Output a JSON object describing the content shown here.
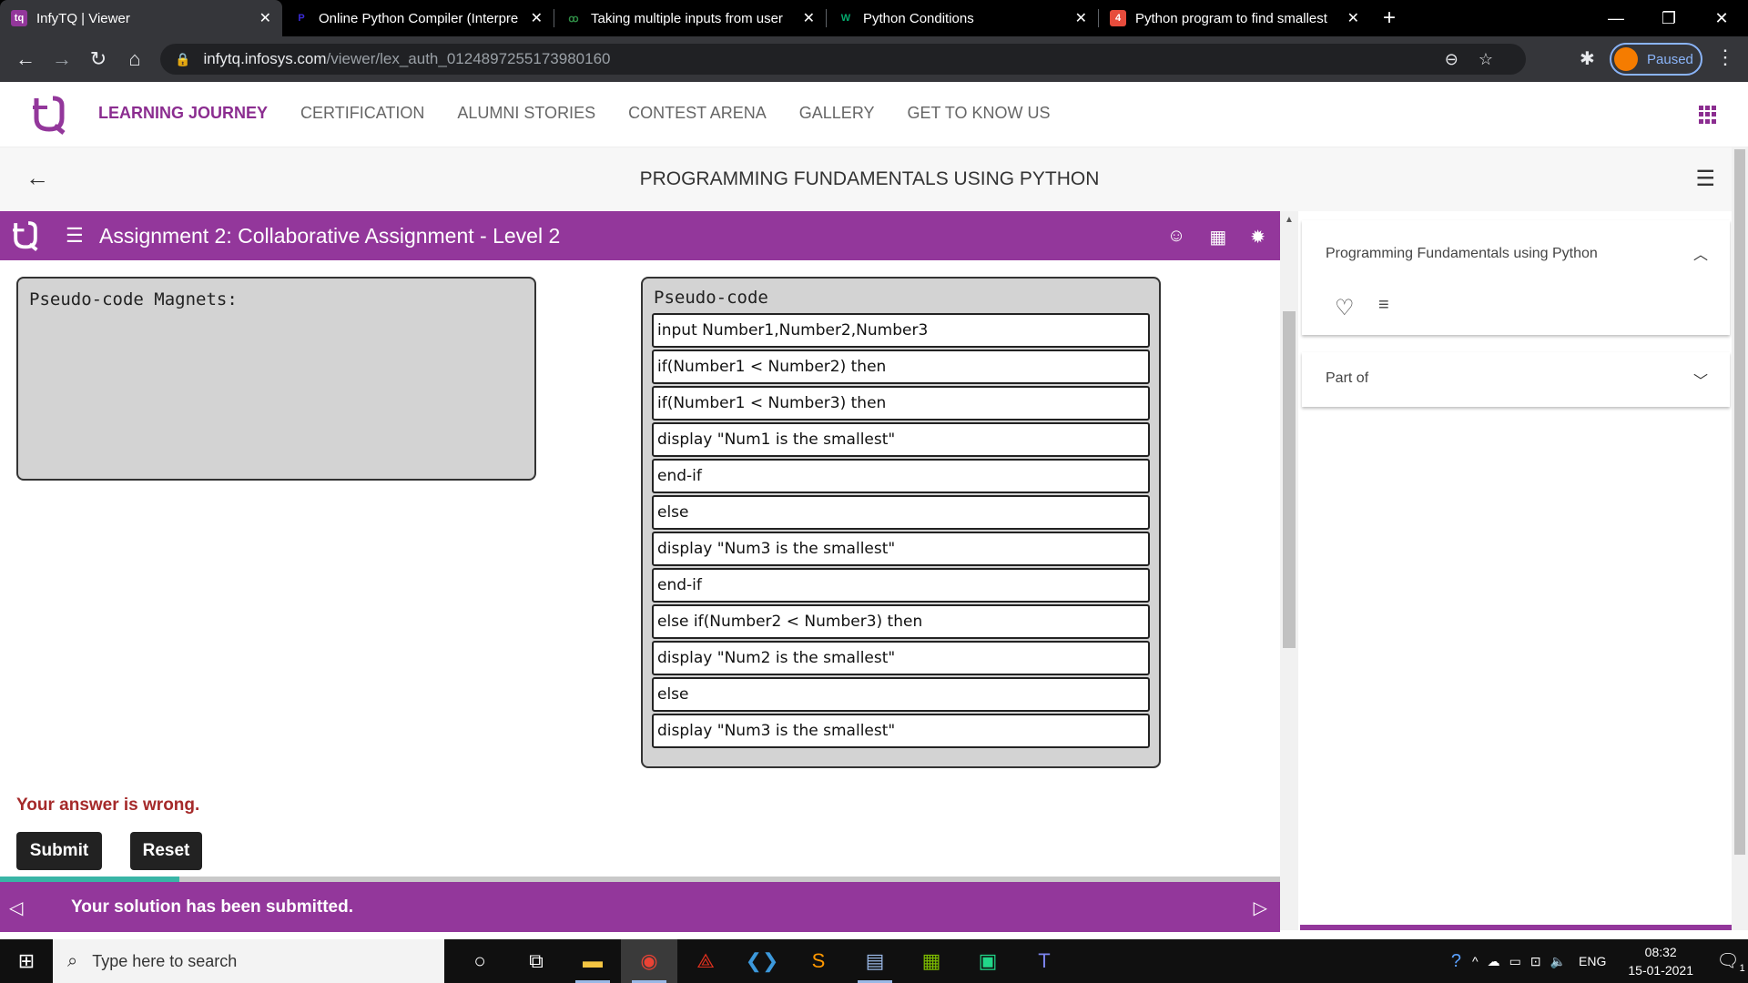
{
  "browser": {
    "tabs": [
      {
        "title": "InfyTQ | Viewer",
        "favicon_color": "#93379b",
        "active": true
      },
      {
        "title": "Online Python Compiler (Interpre",
        "favicon_color": "#3b2bd6"
      },
      {
        "title": "Taking multiple inputs from user",
        "favicon_color": "#2f8d46"
      },
      {
        "title": "Python Conditions",
        "favicon_color": "#04aa6d"
      },
      {
        "title": "Python program to find smallest",
        "favicon_color": "#e74c3c"
      }
    ],
    "url_host": "infytq.infosys.com",
    "url_path": "/viewer/lex_auth_0124897255173980160",
    "profile_label": "Paused"
  },
  "site": {
    "nav": [
      "LEARNING JOURNEY",
      "CERTIFICATION",
      "ALUMNI STORIES",
      "CONTEST ARENA",
      "GALLERY",
      "GET TO KNOW US"
    ],
    "course_title": "PROGRAMMING FUNDAMENTALS USING PYTHON",
    "brand_color": "#93379b"
  },
  "assignment": {
    "title": "Assignment 2: Collaborative Assignment - Level 2",
    "magnets_label": "Pseudo-code Magnets:",
    "pseudo_label": "Pseudo-code",
    "lines": [
      "input Number1,Number2,Number3",
      "if(Number1 < Number2) then",
      "if(Number1 < Number3) then",
      "display \"Num1 is the smallest\"",
      "end-if",
      "else",
      "display \"Num3 is the smallest\"",
      "end-if",
      "else if(Number2 < Number3) then",
      "display \"Num2 is the smallest\"",
      "else",
      "display \"Num3 is the smallest\""
    ],
    "result_message": "Your answer is wrong.",
    "submit_label": "Submit",
    "reset_label": "Reset",
    "status_message": "Your solution has been submitted."
  },
  "side_panel": {
    "card_title": "Programming Fundamentals using Python",
    "part_of_label": "Part of"
  },
  "taskbar": {
    "search_placeholder": "Type here to search",
    "language": "ENG",
    "time": "08:32",
    "date": "15-01-2021",
    "notification_count": "1"
  }
}
